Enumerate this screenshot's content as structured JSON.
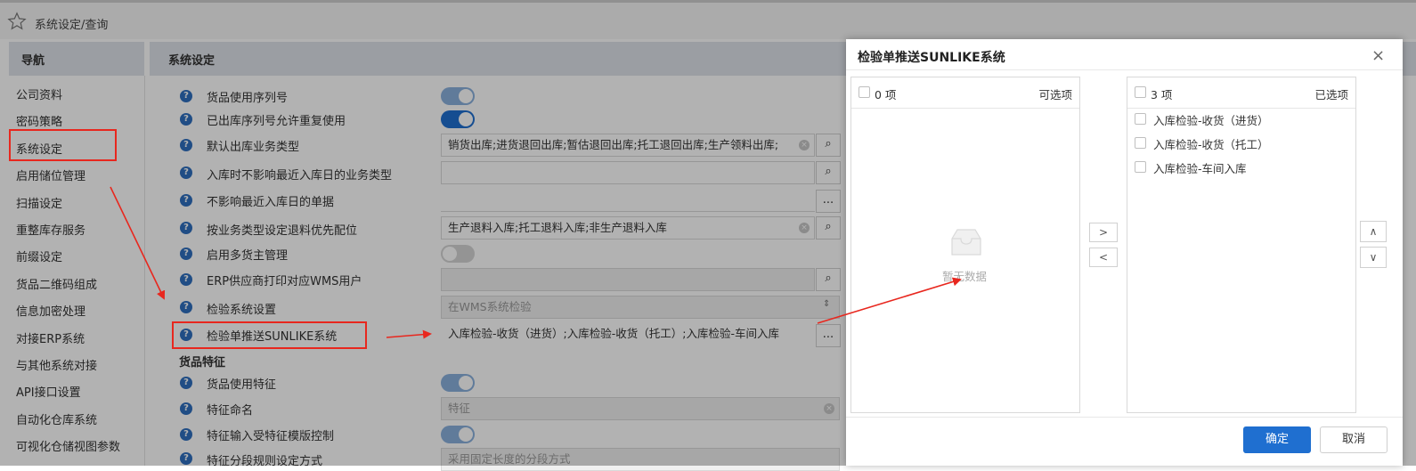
{
  "header": {
    "path": "系统设定/查询"
  },
  "nav": {
    "title": "导航",
    "items": [
      "公司资料",
      "密码策略",
      "系统设定",
      "启用储位管理",
      "扫描设定",
      "重整库存服务",
      "前缀设定",
      "货品二维码组成",
      "信息加密处理",
      "对接ERP系统",
      "与其他系统对接",
      "API接口设置",
      "自动化仓库系统",
      "可视化仓储视图参数"
    ]
  },
  "main": {
    "title": "系统设定",
    "rows": [
      {
        "label": "货品使用序列号"
      },
      {
        "label": "已出库序列号允许重复使用"
      },
      {
        "label": "默认出库业务类型",
        "value": "销货出库;进货退回出库;暂估退回出库;托工退回出库;生产领料出库;"
      },
      {
        "label": "入库时不影响最近入库日的业务类型",
        "value": ""
      },
      {
        "label": "不影响最近入库日的单据",
        "value": ""
      },
      {
        "label": "按业务类型设定退料优先配位",
        "value": "生产退料入库;托工退料入库;非生产退料入库"
      },
      {
        "label": "启用多货主管理"
      },
      {
        "label": "ERP供应商打印对应WMS用户",
        "value": ""
      },
      {
        "label": "检验系统设置",
        "value": "在WMS系统检验"
      },
      {
        "label": "检验单推送SUNLIKE系统",
        "value": "入库检验-收货（进货）;入库检验-收货（托工）;入库检验-车间入库"
      },
      {
        "label": "货品使用特征"
      },
      {
        "label": "特征命名",
        "placeholder": "特征"
      },
      {
        "label": "特征输入受特征模版控制"
      },
      {
        "label": "特征分段规则设定方式",
        "value": "采用固定长度的分段方式"
      }
    ],
    "section_goods": "货品特征",
    "help_glyph": "?",
    "search_glyph": "⌕",
    "more_glyph": "..."
  },
  "modal": {
    "title": "检验单推送SUNLIKE系统",
    "close": "×",
    "left_panel": {
      "count": "0 项",
      "title": "可选项",
      "empty": "暂无数据"
    },
    "right_panel": {
      "count": "3 项",
      "title": "已选项",
      "items": [
        "入库检验-收货（进货）",
        "入库检验-收货（托工）",
        "入库检验-车间入库"
      ]
    },
    "move_right": ">",
    "move_left": "<",
    "move_up": "∧",
    "move_down": "∨",
    "ok": "确定",
    "cancel": "取消"
  },
  "colors": {
    "accent": "#1f6fd0",
    "annotation": "#e8271e"
  }
}
